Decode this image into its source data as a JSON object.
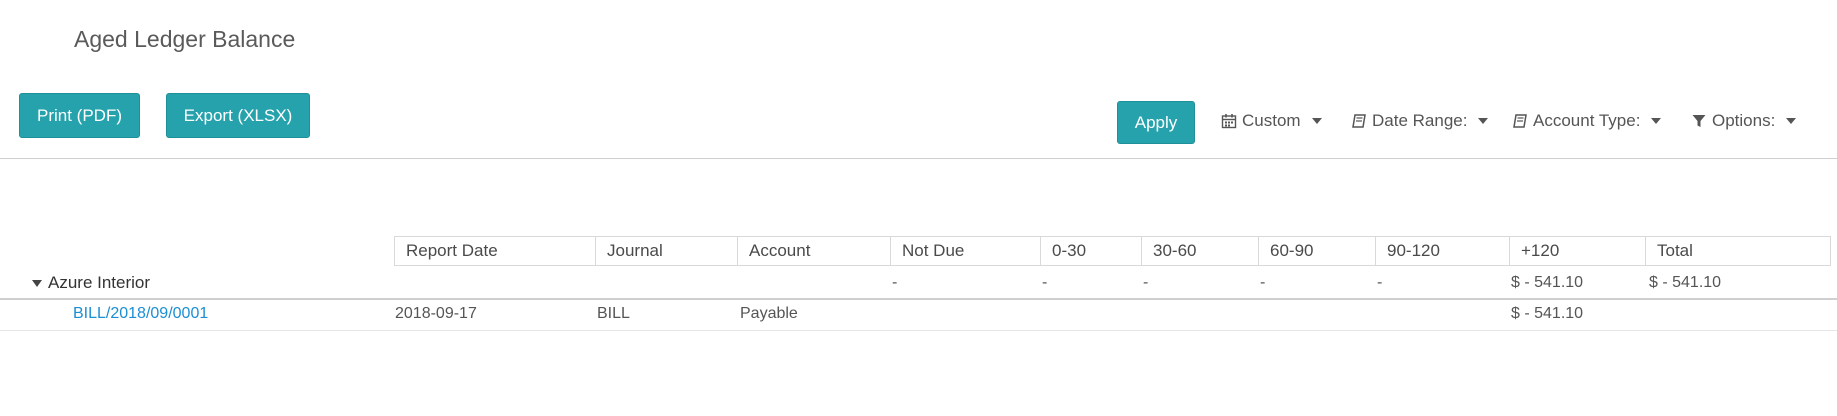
{
  "page": {
    "title": "Aged Ledger Balance"
  },
  "toolbar": {
    "print_label": "Print (PDF)",
    "export_label": "Export (XLSX)",
    "apply_label": "Apply",
    "filters": {
      "custom": "Custom",
      "date_range": "Date Range:",
      "account_type": "Account Type:",
      "options": "Options:"
    },
    "accent_color": "#26a2ad"
  },
  "table": {
    "headers": {
      "report_date": "Report Date",
      "journal": "Journal",
      "account": "Account",
      "not_due": "Not Due",
      "b0_30": "0-30",
      "b30_60": "30-60",
      "b60_90": "60-90",
      "b90_120": "90-120",
      "b120": "+120",
      "total": "Total"
    },
    "partner": {
      "name": "Azure Interior",
      "not_due": "-",
      "b0_30": "-",
      "b30_60": "-",
      "b60_90": "-",
      "b90_120": "-",
      "b120": "$ - 541.10",
      "total": "$ - 541.10"
    },
    "lines": [
      {
        "reference": "BILL/2018/09/0001",
        "report_date": "2018-09-17",
        "journal": "BILL",
        "account": "Payable",
        "b120": "$ - 541.10"
      }
    ]
  },
  "icons": {
    "custom": "calendar-icon",
    "date_range": "book-icon",
    "account_type": "book-icon",
    "options": "filter-icon"
  }
}
